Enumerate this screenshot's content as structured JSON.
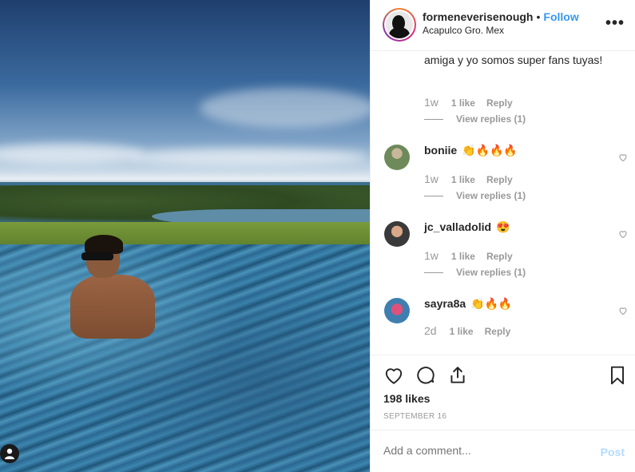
{
  "post": {
    "username": "formeneverisenough",
    "dot": "•",
    "follow_label": "Follow",
    "location": "Acapulco Gro. Mex",
    "more_label": "•••"
  },
  "comments": {
    "continued": {
      "text": "amiga y yo somos super fans tuyas!",
      "time": "1w",
      "likes": "1 like",
      "reply_label": "Reply",
      "view_replies": "View replies (1)"
    },
    "items": [
      {
        "username": "boniie",
        "emoji": "👏🔥🔥🔥",
        "time": "1w",
        "likes": "1 like",
        "reply_label": "Reply",
        "view_replies": "View replies (1)"
      },
      {
        "username": "jc_valladolid",
        "emoji": "😍",
        "time": "1w",
        "likes": "1 like",
        "reply_label": "Reply",
        "view_replies": "View replies (1)"
      },
      {
        "username": "sayra8a",
        "emoji": "👏🔥🔥",
        "time": "2d",
        "likes": "1 like",
        "reply_label": "Reply"
      }
    ]
  },
  "actions": {
    "likes": "198 likes",
    "date": "SEPTEMBER 16"
  },
  "comment_box": {
    "placeholder": "Add a comment...",
    "post_label": "Post"
  },
  "colors": {
    "accent": "#3897f0",
    "muted": "#999999",
    "post_disabled": "#b3dbff"
  },
  "icons": [
    "user-icon",
    "more-icon",
    "heart-icon",
    "comment-icon",
    "share-icon",
    "bookmark-icon"
  ]
}
